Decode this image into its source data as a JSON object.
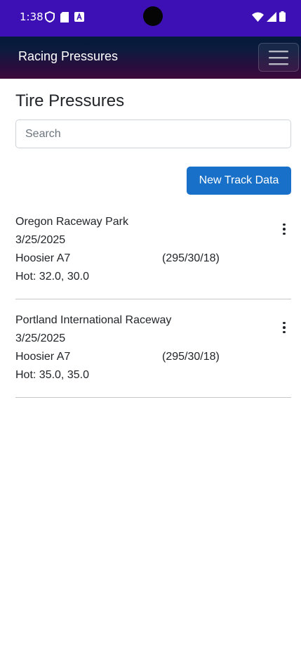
{
  "status_bar": {
    "time": "1:38",
    "left_icons": [
      "shield-icon",
      "sd-card-icon",
      "keyboard-a-icon"
    ],
    "right_icons": [
      "wifi-icon",
      "signal-icon",
      "battery-icon"
    ],
    "colors": {
      "background": "#3d10b5"
    }
  },
  "navbar": {
    "brand": "Racing Pressures",
    "menu_icon": "hamburger-icon"
  },
  "page": {
    "title": "Tire Pressures",
    "search": {
      "placeholder": "Search",
      "value": ""
    },
    "new_track_label": "New Track Data",
    "accent_color": "#1870c9"
  },
  "tracks": [
    {
      "name": "Oregon Raceway Park",
      "date": "3/25/2025",
      "tire": "Hoosier A7",
      "size": "(295/30/18)",
      "hot": "Hot: 32.0, 30.0",
      "menu_icon": "kebab-menu-icon"
    },
    {
      "name": "Portland International Raceway",
      "date": "3/25/2025",
      "tire": "Hoosier A7",
      "size": "(295/30/18)",
      "hot": "Hot: 35.0, 35.0",
      "menu_icon": "kebab-menu-icon"
    }
  ]
}
